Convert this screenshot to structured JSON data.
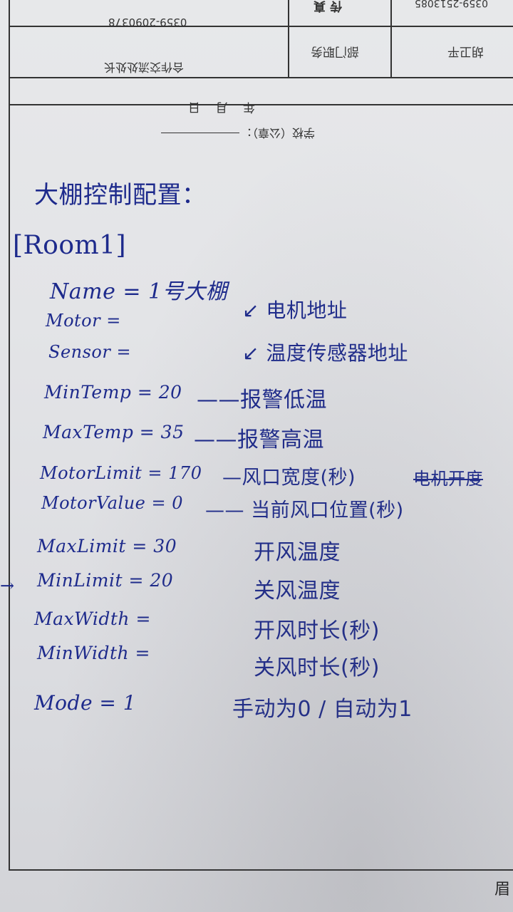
{
  "printed_form": {
    "phone_top_right": "0359-2513085",
    "fax_label": "传 真",
    "phone_left": "0359-2090378",
    "contact_name": "胡卫平",
    "dept_title_label": "部门职务",
    "dept_value": "合作交流处处长",
    "date_label": "年  月  日",
    "school_seal_label": "学校（公章）："
  },
  "notes": {
    "title": "大棚控制配置：",
    "section": "[Room1]",
    "lines": [
      {
        "key": "Name = 1号大棚",
        "comment": ""
      },
      {
        "key": "Motor =",
        "comment": "↙ 电机地址"
      },
      {
        "key": "Sensor =",
        "comment": "↙ 温度传感器地址"
      },
      {
        "key": "MinTemp = 20",
        "comment": "——报警低温"
      },
      {
        "key": "MaxTemp = 35",
        "comment": "——报警高温"
      },
      {
        "key": "MotorLimit = 170",
        "comment": "—风口宽度(秒)",
        "struck": "电机开度"
      },
      {
        "key": "MotorValue = 0",
        "comment": "—— 当前风口位置(秒)"
      },
      {
        "key": "MaxLimit = 30",
        "comment": "开风温度"
      },
      {
        "key": "MinLimit = 20",
        "comment": "关风温度"
      },
      {
        "key": "MaxWidth =",
        "comment": "开风时长(秒)"
      },
      {
        "key": "MinWidth =",
        "comment": "关风时长(秒)"
      },
      {
        "key": "Mode = 1",
        "comment": "手动为0 / 自动为1"
      }
    ],
    "arrow_marker": "→"
  },
  "corner_glyph": "眉",
  "colors": {
    "ink": "#1d2a8c",
    "print": "#333333",
    "paper": "#e4e5e8"
  }
}
